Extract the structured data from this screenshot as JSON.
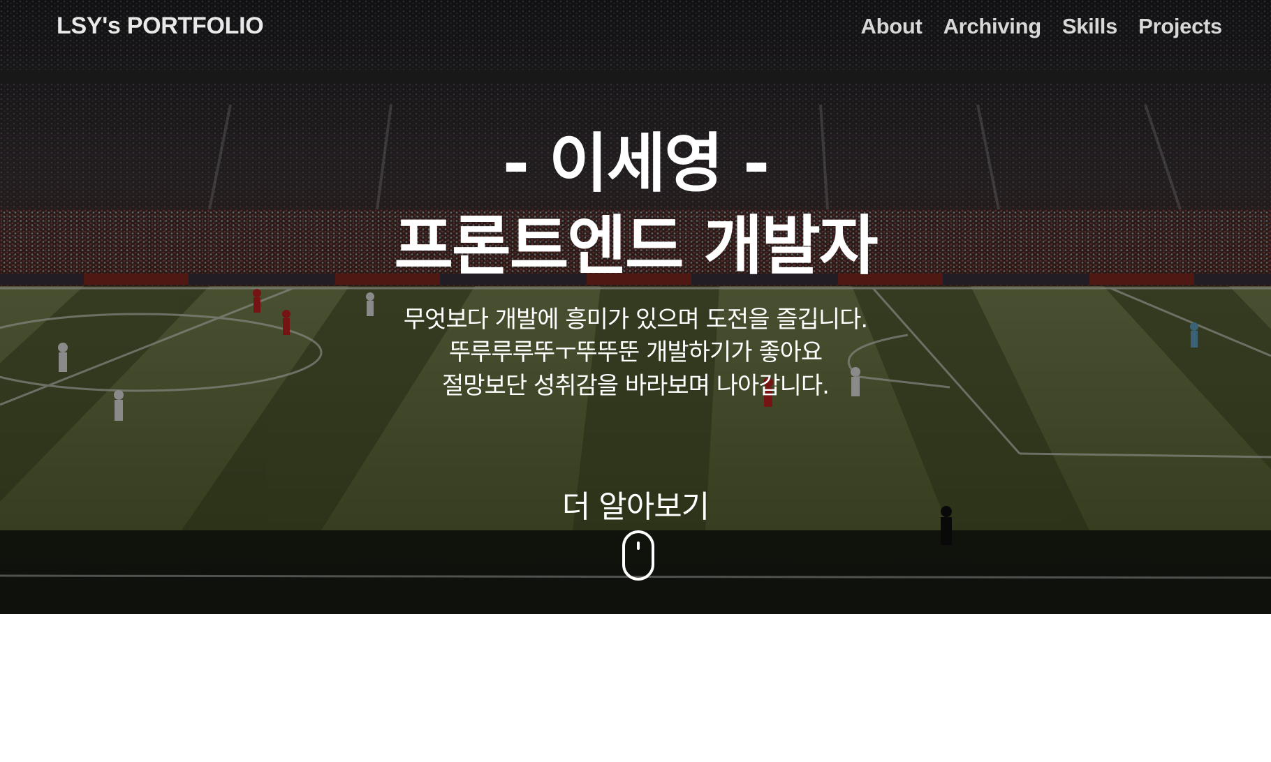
{
  "navbar": {
    "brand": "LSY's PORTFOLIO",
    "links": [
      "About",
      "Archiving",
      "Skills",
      "Projects"
    ]
  },
  "hero": {
    "title_line1": "- 이세영 -",
    "title_line2": "프론트엔드 개발자",
    "description": [
      "무엇보다 개발에 흥미가 있으며 도전을 즐깁니다.",
      "뚜루루루뚜ㅜ뚜뚜뚠 개발하기가 좋아요",
      "절망보단 성취감을 바라보며 나아갑니다."
    ],
    "more_label": "더 알아보기",
    "scroll_icon": "mouse-scroll-icon",
    "background_image": "football-stadium-photo"
  },
  "colors": {
    "nav_text": "#d8d8d8",
    "hero_text": "#ffffff",
    "page_background": "#ffffff"
  }
}
